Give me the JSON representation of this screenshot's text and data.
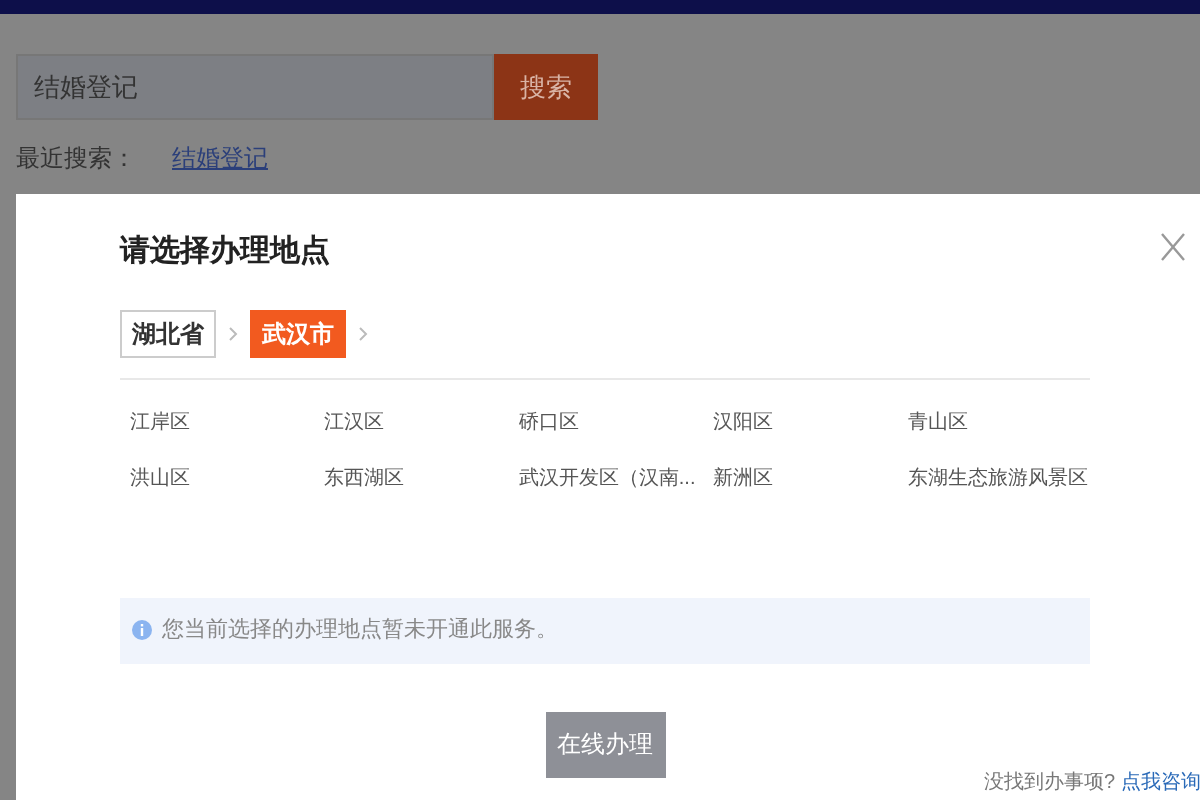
{
  "search": {
    "value": "结婚登记",
    "button": "搜索"
  },
  "recent": {
    "label": "最近搜索：",
    "items": [
      "结婚登记"
    ]
  },
  "dialog": {
    "title": "请选择办理地点",
    "breadcrumb": [
      {
        "label": "湖北省",
        "selected": false
      },
      {
        "label": "武汉市",
        "selected": true
      }
    ],
    "districts": [
      "江岸区",
      "江汉区",
      "硚口区",
      "汉阳区",
      "青山区",
      "洪山区",
      "东西湖区",
      "武汉开发区（汉南...",
      "新洲区",
      "东湖生态旅游风景区"
    ],
    "notice": "您当前选择的办理地点暂未开通此服务。",
    "button": {
      "label": "在线办理",
      "disabled": true
    },
    "help": {
      "text": "没找到办事项?",
      "link": "点我咨询"
    }
  }
}
